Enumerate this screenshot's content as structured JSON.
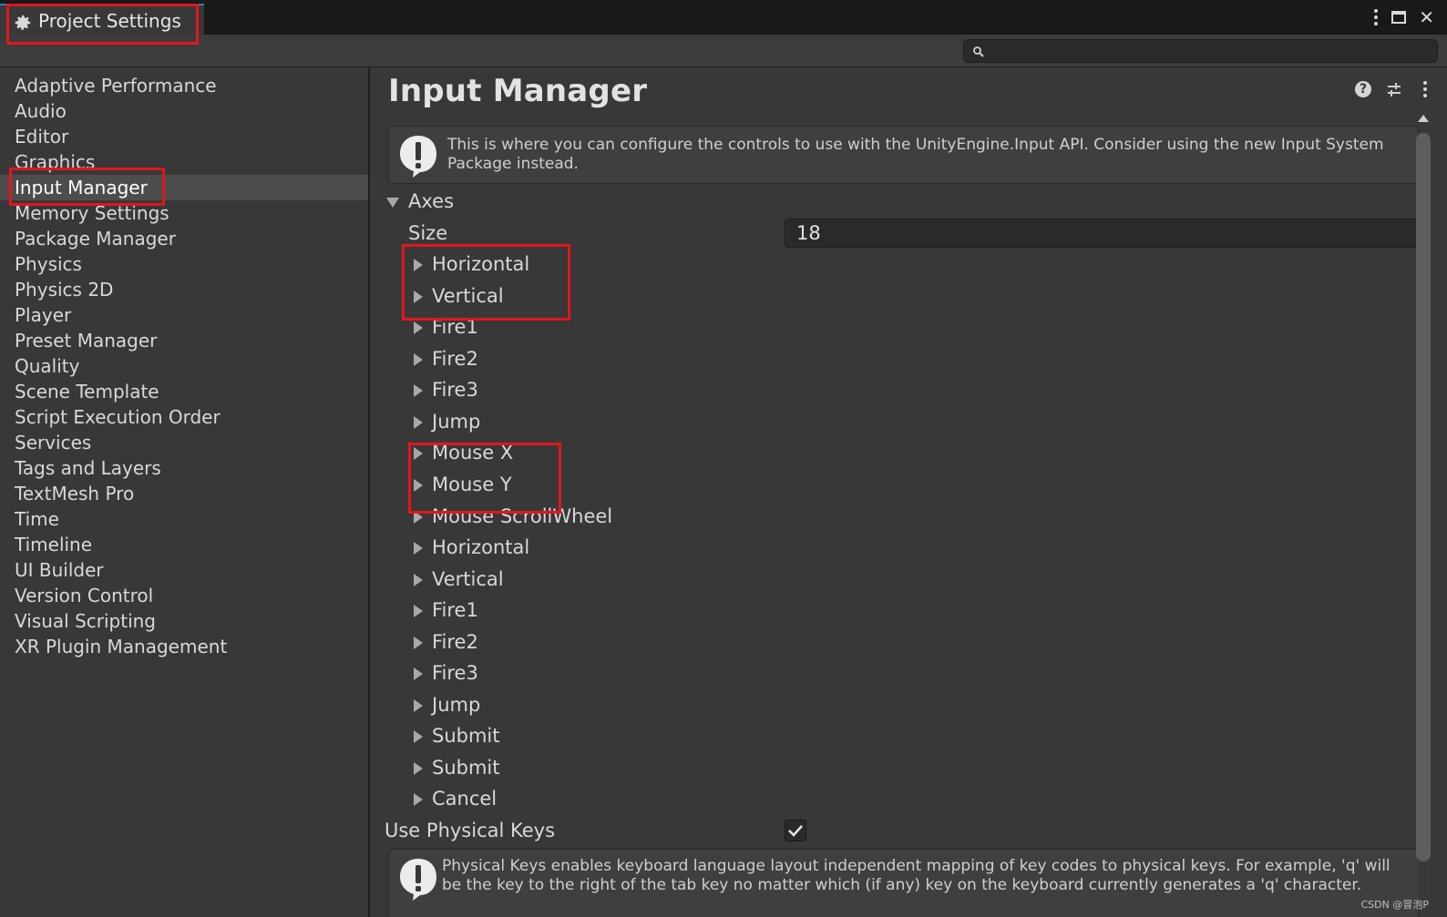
{
  "window": {
    "tab_title": "Project Settings",
    "tab_icon": "gear-icon",
    "controls": [
      "more-icon",
      "maximize-icon",
      "close-icon"
    ]
  },
  "toolbar": {
    "search_value": "",
    "search_icon": "search-icon"
  },
  "sidebar": {
    "items": [
      {
        "label": "Adaptive Performance"
      },
      {
        "label": "Audio"
      },
      {
        "label": "Editor"
      },
      {
        "label": "Graphics"
      },
      {
        "label": "Input Manager",
        "selected": true
      },
      {
        "label": "Memory Settings"
      },
      {
        "label": "Package Manager"
      },
      {
        "label": "Physics"
      },
      {
        "label": "Physics 2D"
      },
      {
        "label": "Player"
      },
      {
        "label": "Preset Manager"
      },
      {
        "label": "Quality"
      },
      {
        "label": "Scene Template"
      },
      {
        "label": "Script Execution Order"
      },
      {
        "label": "Services"
      },
      {
        "label": "Tags and Layers"
      },
      {
        "label": "TextMesh Pro"
      },
      {
        "label": "Time"
      },
      {
        "label": "Timeline"
      },
      {
        "label": "UI Builder"
      },
      {
        "label": "Version Control"
      },
      {
        "label": "Visual Scripting"
      },
      {
        "label": "XR Plugin Management"
      }
    ]
  },
  "main": {
    "title": "Input Manager",
    "header_icons": [
      "help-icon",
      "preset-icon",
      "more-icon"
    ],
    "info_message": "This is where you can configure the controls to use with the UnityEngine.Input API. Consider using the new Input System Package instead.",
    "axes": {
      "label": "Axes",
      "size_label": "Size",
      "size_value": "18",
      "items": [
        "Horizontal",
        "Vertical",
        "Fire1",
        "Fire2",
        "Fire3",
        "Jump",
        "Mouse X",
        "Mouse Y",
        "Mouse ScrollWheel",
        "Horizontal",
        "Vertical",
        "Fire1",
        "Fire2",
        "Fire3",
        "Jump",
        "Submit",
        "Submit",
        "Cancel"
      ]
    },
    "use_physical_keys": {
      "label": "Use Physical Keys",
      "checked": true
    },
    "physical_keys_message": "Physical Keys enables keyboard language layout independent mapping of key codes to physical keys. For example, 'q' will be the key to the right of the tab key no matter which (if any) key on the keyboard currently generates a 'q' character."
  },
  "annotation_color": "#e1161f",
  "watermark": "CSDN @冒泡P"
}
